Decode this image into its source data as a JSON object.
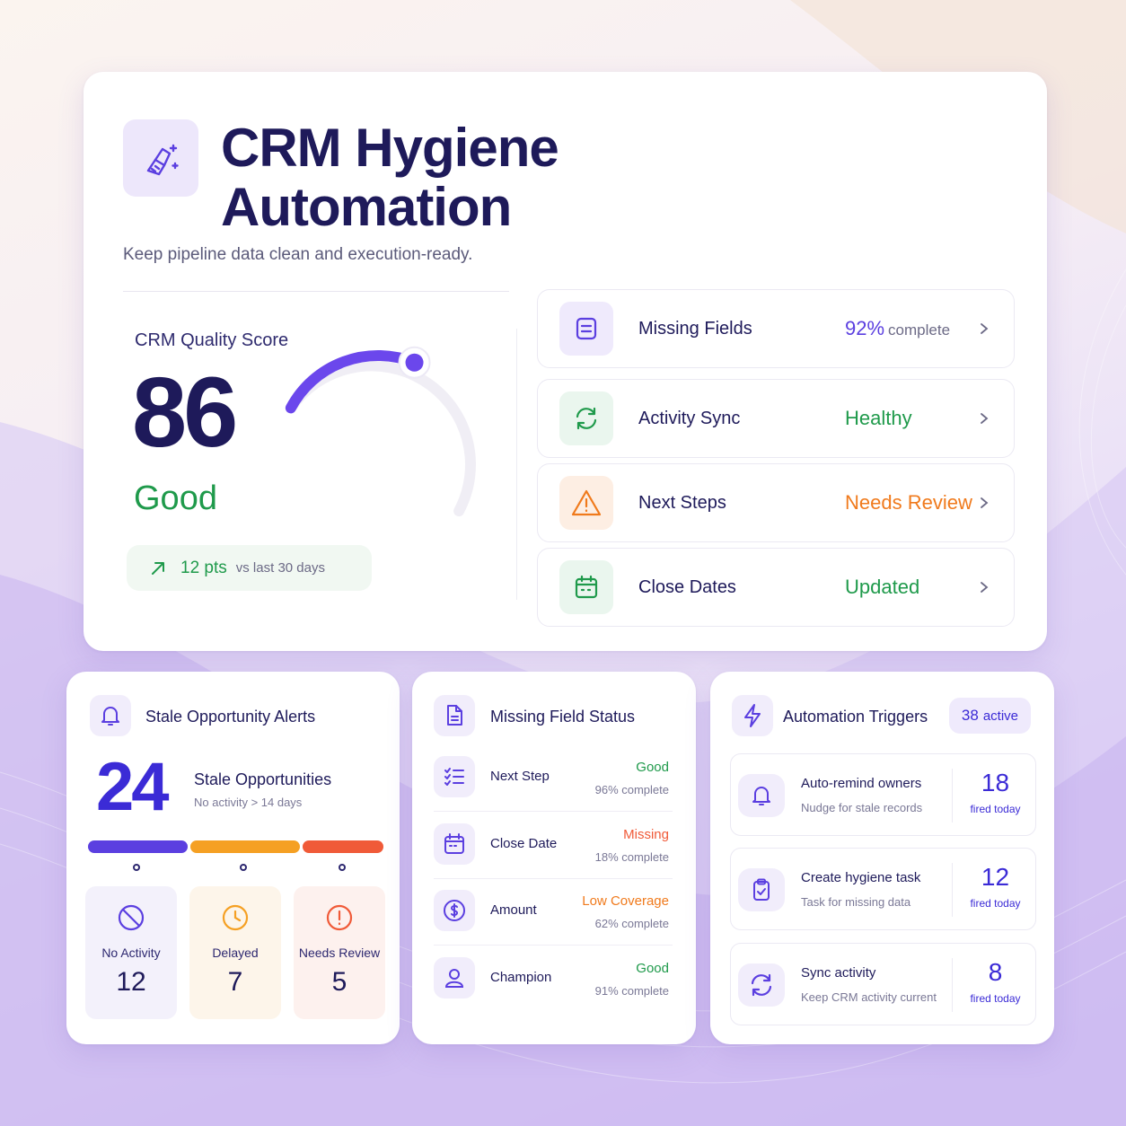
{
  "header": {
    "title": "CRM Hygiene Automation",
    "subtitle": "Keep pipeline data clean and execution-ready.",
    "icon": "broom-sparkle-icon"
  },
  "quality_score": {
    "label": "CRM Quality Score",
    "value": "86",
    "status": "Good",
    "gauge_fraction": 0.86,
    "trend_value": "12 pts",
    "trend_label": "vs last 30 days"
  },
  "status_rows": [
    {
      "name": "Missing Fields",
      "value": "92%",
      "suffix": "complete",
      "icon": "document-icon",
      "color": "#5b3fe0"
    },
    {
      "name": "Activity Sync",
      "value": "Healthy",
      "suffix": "",
      "icon": "sync-icon",
      "color": "#1f9a4b"
    },
    {
      "name": "Next Steps",
      "value": "Needs Review",
      "suffix": "",
      "icon": "warning-icon",
      "color": "#f07a1c"
    },
    {
      "name": "Close Dates",
      "value": "Updated",
      "suffix": "",
      "icon": "calendar-icon",
      "color": "#1f9a4b"
    }
  ],
  "stale": {
    "title": "Stale Opportunity Alerts",
    "count": "24",
    "label": "Stale Opportunities",
    "sub": "No activity > 14 days",
    "tiles": [
      {
        "label": "No Activity",
        "value": "12",
        "icon": "ban-icon",
        "color": "#5b3fe0"
      },
      {
        "label": "Delayed",
        "value": "7",
        "icon": "clock-icon",
        "color": "#f5a023"
      },
      {
        "label": "Needs Review",
        "value": "5",
        "icon": "alert-circle-icon",
        "color": "#f05a38"
      }
    ]
  },
  "fields": {
    "title": "Missing Field Status",
    "rows": [
      {
        "name": "Next Step",
        "status": "Good",
        "pct": "96% complete",
        "icon": "checklist-icon",
        "color": "#1f9a4b"
      },
      {
        "name": "Close Date",
        "status": "Missing",
        "pct": "18% complete",
        "icon": "calendar-icon",
        "color": "#f05a38"
      },
      {
        "name": "Amount",
        "status": "Low Coverage",
        "pct": "62% complete",
        "icon": "dollar-icon",
        "color": "#f07a1c"
      },
      {
        "name": "Champion",
        "status": "Good",
        "pct": "91% complete",
        "icon": "user-icon",
        "color": "#1f9a4b"
      }
    ]
  },
  "triggers": {
    "title": "Automation Triggers",
    "active_count": "38",
    "active_label": "active",
    "rows": [
      {
        "name": "Auto-remind owners",
        "sub": "Nudge for stale records",
        "count": "18",
        "unit": "fired today",
        "icon": "bell-icon"
      },
      {
        "name": "Create hygiene task",
        "sub": "Task for missing data",
        "count": "12",
        "unit": "fired today",
        "icon": "clipboard-check-icon"
      },
      {
        "name": "Sync activity",
        "sub": "Keep CRM activity current",
        "count": "8",
        "unit": "fired today",
        "icon": "sync-icon"
      }
    ]
  }
}
